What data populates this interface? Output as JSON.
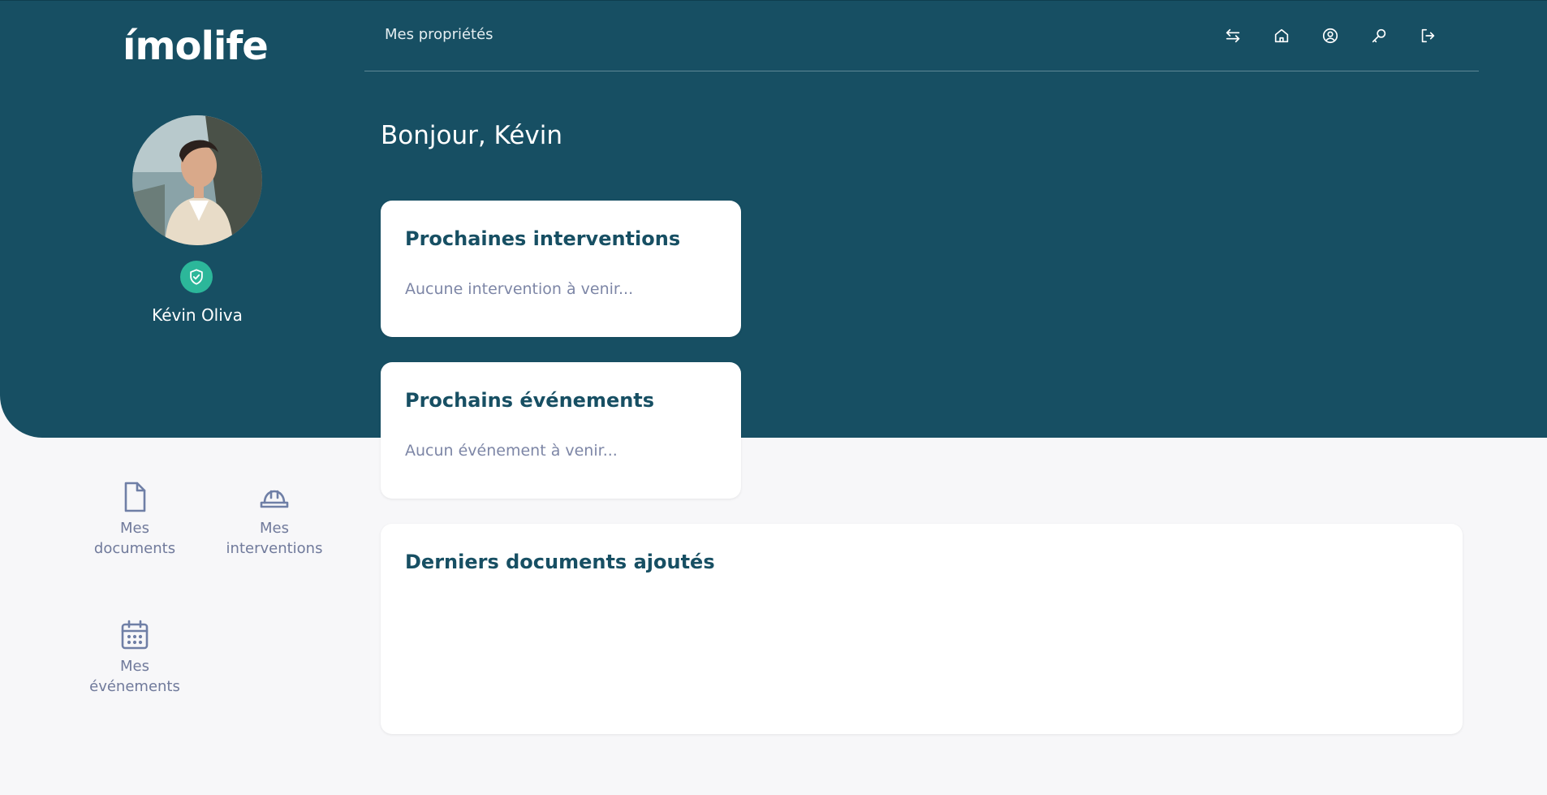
{
  "brand": {
    "name": "ímolife"
  },
  "nav": {
    "properties_label": "Mes propriétés"
  },
  "toolbar": {
    "icons": [
      "switch-arrows-icon",
      "home-icon",
      "user-circle-icon",
      "key-icon",
      "logout-icon"
    ]
  },
  "user": {
    "name": "Kévin Oliva",
    "verified_icon": "shield-check-icon"
  },
  "main": {
    "greeting": "Bonjour, Kévin",
    "interventions_card": {
      "title": "Prochaines interventions",
      "empty_text": "Aucune intervention à venir..."
    },
    "events_card": {
      "title": "Prochains événements",
      "empty_text": "Aucun événement à venir..."
    },
    "documents_card": {
      "title": "Derniers documents ajoutés"
    }
  },
  "quick_links": {
    "documents": {
      "line1": "Mes",
      "line2": "documents",
      "icon": "document-icon"
    },
    "interventions": {
      "line1": "Mes",
      "line2": "interventions",
      "icon": "hard-hat-icon"
    },
    "events": {
      "line1": "Mes",
      "line2": "événements",
      "icon": "calendar-icon"
    }
  },
  "colors": {
    "primary": "#174f63",
    "verified_badge": "#2cb79a",
    "muted_text": "#7d86a6",
    "background": "#f7f7f9"
  }
}
